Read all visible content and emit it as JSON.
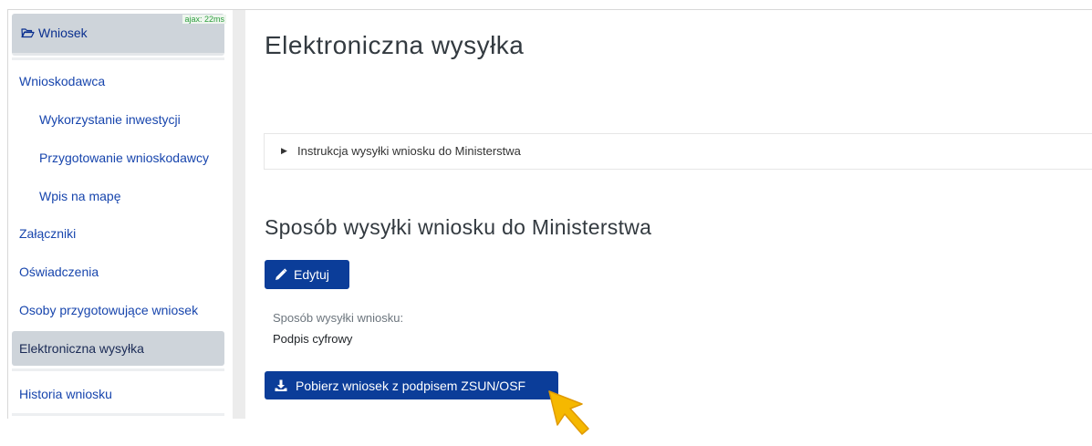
{
  "sidebar": {
    "top_item": {
      "label": "Wniosek",
      "icon": "folder-open-icon",
      "ajax_badge": "ajax: 22ms"
    },
    "items": [
      {
        "label": "Wnioskodawca"
      },
      {
        "label": "Wykorzystanie inwestycji"
      },
      {
        "label": "Przygotowanie wnioskodawcy"
      },
      {
        "label": "Wpis na mapę"
      },
      {
        "label": "Załączniki"
      },
      {
        "label": "Oświadczenia"
      },
      {
        "label": "Osoby przygotowujące wniosek"
      },
      {
        "label": "Elektroniczna wysyłka"
      },
      {
        "label": "Historia wniosku"
      }
    ],
    "active_item": "Elektroniczna wysyłka"
  },
  "main": {
    "title": "Elektroniczna wysyłka",
    "instructions_label": "Instrukcja wysyłki wniosku do Ministerstwa",
    "section_title": "Sposób wysyłki wniosku do Ministerstwa",
    "edit_button": "Edytuj",
    "field_label": "Sposób wysyłki wniosku:",
    "field_value": "Podpis cyfrowy",
    "download_button": "Pobierz wniosek z podpisem ZSUN/OSF"
  },
  "colors": {
    "primary_button": "#0b3d99",
    "link": "#1745ad",
    "active_bg": "#ced4da",
    "cursor": "#f5b800"
  }
}
